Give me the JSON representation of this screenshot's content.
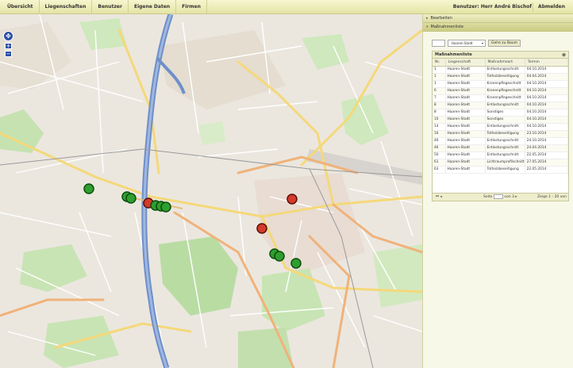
{
  "nav": {
    "items": [
      "Übersicht",
      "Liegenschaften",
      "Benutzer",
      "Eigene Daten",
      "Firmen"
    ],
    "user": "Benutzer: Herr André Bischof",
    "logout": "Abmelden"
  },
  "map": {
    "pan_symbol": "✥",
    "zoom_in": "+",
    "zoom_out": "−",
    "marker_colors": {
      "green": "#2f9e2f",
      "red": "#d33a2c"
    }
  },
  "panel": {
    "accordion": [
      {
        "label": "Bearbeiten",
        "collapsed": true
      },
      {
        "label": "Maßnahmenliste",
        "collapsed": false
      }
    ],
    "filter_select": "Haaren-Stadt",
    "goto_button": "Gehe zu Baum",
    "list_title": "Maßnahmenliste",
    "columns": [
      "Nr.",
      "Liegenschaft",
      "Maßnahmeart",
      "Termin"
    ],
    "rows": [
      [
        "1",
        "Haaren-Stadt",
        "Entlastungsschnitt",
        "04.10.2014"
      ],
      [
        "1",
        "Haaren-Stadt",
        "Totholzbeseitigung",
        "04.04.2014"
      ],
      [
        "1",
        "Haaren-Stadt",
        "Kronenpflegeschnitt",
        "04.10.2014"
      ],
      [
        "6",
        "Haaren-Stadt",
        "Kronenpflegeschnitt",
        "04.10.2014"
      ],
      [
        "7",
        "Haaren-Stadt",
        "Kronenpflegeschnitt",
        "04.10.2014"
      ],
      [
        "8",
        "Haaren-Stadt",
        "Entlastungsschnitt",
        "04.10.2014"
      ],
      [
        "8",
        "Haaren-Stadt",
        "Sonstiges",
        "04.10.2014"
      ],
      [
        "10",
        "Haaren-Stadt",
        "Sonstiges",
        "04.10.2014"
      ],
      [
        "14",
        "Haaren-Stadt",
        "Entlastungsschnitt",
        "04.10.2014"
      ],
      [
        "16",
        "Haaren-Stadt",
        "Totholzbeseitigung",
        "23.10.2014"
      ],
      [
        "46",
        "Haaren-Stadt",
        "Entlastungsschnitt",
        "24.10.2014"
      ],
      [
        "46",
        "Haaren-Stadt",
        "Entlastungsschnitt",
        "24.04.2014"
      ],
      [
        "50",
        "Haaren-Stadt",
        "Entlastungsschnitt",
        "22.05.2014"
      ],
      [
        "61",
        "Haaren-Stadt",
        "Lichtraumprofilschnitt",
        "27.05.2014"
      ],
      [
        "63",
        "Haaren-Stadt",
        "Totholzbeseitigung",
        "22.05.2014"
      ]
    ],
    "pager": {
      "page_label": "Seite",
      "page_value": "1",
      "of_label": "von 3",
      "range_label": "Zeige 1 - 20 von"
    }
  }
}
